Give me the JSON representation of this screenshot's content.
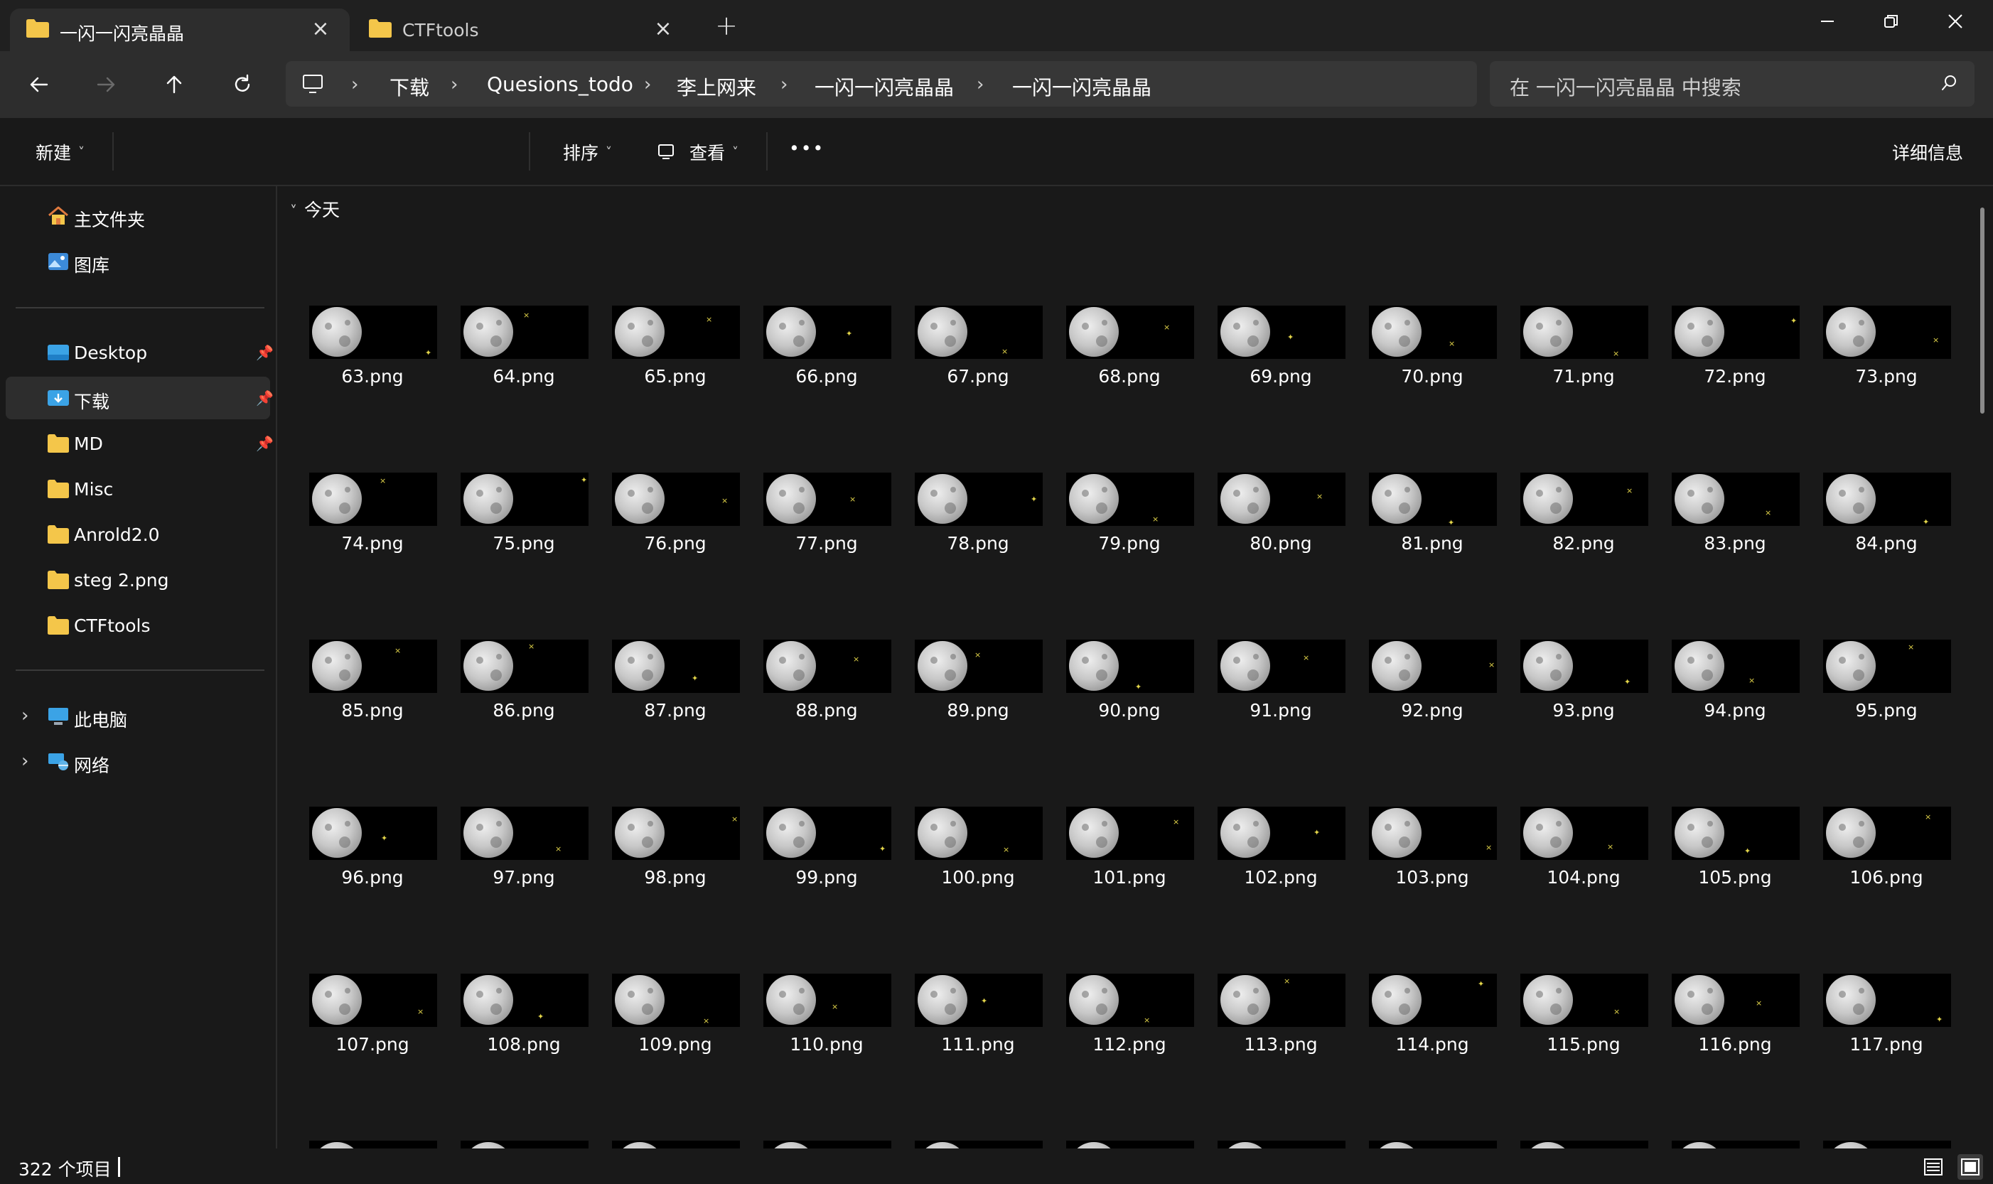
{
  "tabs": [
    {
      "title": "一闪一闪亮晶晶",
      "active": true
    },
    {
      "title": "CTFtools",
      "active": false
    }
  ],
  "address": {
    "breadcrumbs": [
      "下载",
      "Quesions_todo",
      "李上网来",
      "一闪一闪亮晶晶",
      "一闪一闪亮晶晶"
    ],
    "search_placeholder": "在 一闪一闪亮晶晶 中搜索"
  },
  "commandbar": {
    "new_label": "新建",
    "sort_label": "排序",
    "view_label": "查看",
    "more_label": "•••",
    "details_label": "详细信息"
  },
  "sidebar": {
    "top_items": [
      {
        "label": "主文件夹",
        "icon": "home-icon"
      },
      {
        "label": "图库",
        "icon": "gallery-icon"
      }
    ],
    "pinned_items": [
      {
        "label": "Desktop",
        "icon": "desktop-folder-icon",
        "pinned": true
      },
      {
        "label": "下载",
        "icon": "downloads-folder-icon",
        "pinned": true,
        "selected": true
      },
      {
        "label": "MD",
        "icon": "folder-icon",
        "pinned": true
      },
      {
        "label": "Misc",
        "icon": "folder-icon",
        "pinned": false
      },
      {
        "label": "Anrold2.0",
        "icon": "folder-icon",
        "pinned": false
      },
      {
        "label": "steg 2.png",
        "icon": "folder-icon",
        "pinned": false
      },
      {
        "label": "CTFtools",
        "icon": "folder-icon",
        "pinned": false
      }
    ],
    "bottom_items": [
      {
        "label": "此电脑",
        "icon": "this-pc-icon"
      },
      {
        "label": "网络",
        "icon": "network-icon"
      }
    ]
  },
  "content": {
    "group_header": "今天",
    "files": [
      "63.png",
      "64.png",
      "65.png",
      "66.png",
      "67.png",
      "68.png",
      "69.png",
      "70.png",
      "71.png",
      "72.png",
      "73.png",
      "74.png",
      "75.png",
      "76.png",
      "77.png",
      "78.png",
      "79.png",
      "80.png",
      "81.png",
      "82.png",
      "83.png",
      "84.png",
      "85.png",
      "86.png",
      "87.png",
      "88.png",
      "89.png",
      "90.png",
      "91.png",
      "92.png",
      "93.png",
      "94.png",
      "95.png",
      "96.png",
      "97.png",
      "98.png",
      "99.png",
      "100.png",
      "101.png",
      "102.png",
      "103.png",
      "104.png",
      "105.png",
      "106.png",
      "107.png",
      "108.png",
      "109.png",
      "110.png",
      "111.png",
      "112.png",
      "113.png",
      "114.png",
      "115.png",
      "116.png",
      "117.png"
    ]
  },
  "status": {
    "item_count": "322 个项目"
  },
  "colors": {
    "background": "#191919",
    "chrome": "#2d2d2d",
    "star": "#e3d54a",
    "folder": "#f4c64a"
  }
}
